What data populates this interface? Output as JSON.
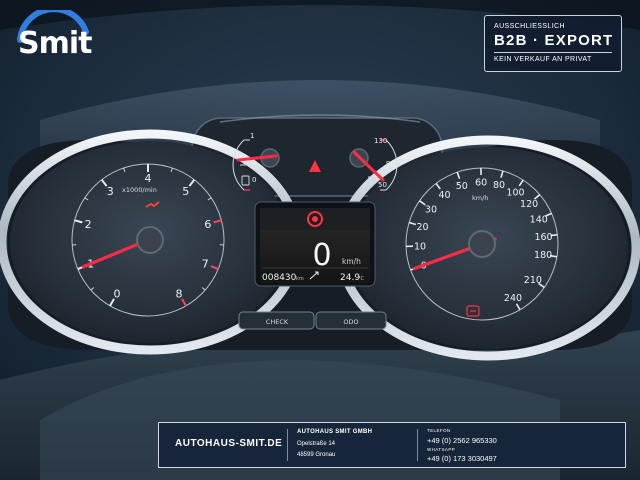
{
  "logo": {
    "name": "Smit"
  },
  "badge": {
    "top": "AUSSCHLIESSLICH",
    "main": "B2B  ·  EXPORT",
    "bottom": "KEIN VERKAUF AN PRIVAT"
  },
  "tachometer": {
    "unit": "x1000/min",
    "ticks": [
      "0",
      "1",
      "2",
      "3",
      "4",
      "5",
      "6",
      "7",
      "8"
    ],
    "reading": 1
  },
  "speedometer": {
    "unit": "km/h",
    "ticks": [
      "0",
      "10",
      "20",
      "30",
      "40",
      "50",
      "60",
      "80",
      "100",
      "120",
      "140",
      "160",
      "180",
      "210",
      "240"
    ],
    "reading": 0
  },
  "fuel_gauge": {
    "ticks": [
      "1",
      "1/2",
      "0"
    ]
  },
  "temp_gauge": {
    "ticks": [
      "130",
      "90",
      "50"
    ]
  },
  "display": {
    "speed_value": "0",
    "speed_unit": "km/h",
    "odometer": "008430",
    "odometer_unit": "km",
    "temperature": "24.9",
    "temperature_unit": "°C"
  },
  "buttons": {
    "check": "CHECK",
    "odo": "ODO"
  },
  "footer": {
    "website": "AUTOHAUS-SMIT.DE",
    "company": "AUTOHAUS SMIT GMBH",
    "street": "Opelstraße 14",
    "city": "48599 Gronau",
    "telefon_label": "TELEFON",
    "telefon": "+49 (0) 2562 965330",
    "whatsapp_label": "WHATSAPP",
    "whatsapp": "+49 (0) 173 3030497"
  },
  "colors": {
    "needle": "#ff2a44",
    "badge_bg": "#121e30",
    "footer_bg": "#17253a"
  }
}
